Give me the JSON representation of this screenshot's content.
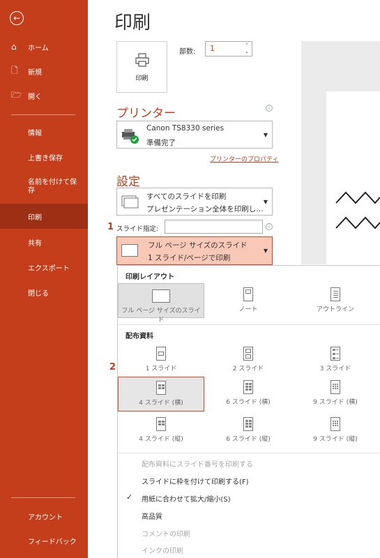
{
  "sidebar": {
    "back_icon": "back-arrow-icon",
    "top_items": [
      {
        "label": "ホーム",
        "icon": "home-icon"
      },
      {
        "label": "新規",
        "icon": "new-file-icon"
      },
      {
        "label": "開く",
        "icon": "open-folder-icon"
      }
    ],
    "items": [
      "情報",
      "上書き保存",
      "名前を付けて保存",
      "印刷",
      "共有",
      "エクスポート",
      "閉じる"
    ],
    "active": "印刷",
    "bottom_items": [
      "アカウント",
      "フィードバック"
    ]
  },
  "main": {
    "title": "印刷",
    "print_button_label": "印刷",
    "copies_label": "部数:",
    "copies_value": "1",
    "printer_heading": "プリンター",
    "printer_name": "Canon TS8330 series",
    "printer_status": "準備完了",
    "printer_properties_link": "プリンターのプロパティ",
    "settings_heading": "設定",
    "slides_range_line1": "すべてのスライドを印刷",
    "slides_range_line2": "プレゼンテーション全体を印刷し…",
    "slide_specify_label": "スライド指定:",
    "slide_specify_value": "",
    "layout_line1": "フル ページ サイズのスライド",
    "layout_line2": "1 スライド/ページで印刷",
    "marker1": "1",
    "marker2": "2"
  },
  "panel": {
    "print_layout_title": "印刷レイアウト",
    "layout_options": [
      "フル ページ サイズのスライド",
      "ノート",
      "アウトライン"
    ],
    "handouts_title": "配布資料",
    "handouts_row1": [
      "1 スライド",
      "2 スライド",
      "3 スライド"
    ],
    "handouts_row2": [
      "4 スライド (横)",
      "6 スライド (横)",
      "9 スライド (横)"
    ],
    "handouts_row3": [
      "4 スライド (縦)",
      "6 スライド (縦)",
      "9 スライド (縦)"
    ],
    "menu_items": [
      {
        "label": "配布資料にスライド番号を印刷する",
        "enabled": false,
        "checked": false
      },
      {
        "label": "スライドに枠を付けて印刷する(F)",
        "enabled": true,
        "checked": false
      },
      {
        "label": "用紙に合わせて拡大/縮小(S)",
        "enabled": true,
        "checked": true
      },
      {
        "label": "高品質",
        "enabled": true,
        "checked": false
      },
      {
        "label": "コメントの印刷",
        "enabled": false,
        "checked": false
      },
      {
        "label": "インクの印刷",
        "enabled": false,
        "checked": false
      }
    ]
  },
  "colors": {
    "accent": "#c43e1c",
    "sidebar_active": "#9c2f14",
    "highlight": "#f9c8b6"
  }
}
